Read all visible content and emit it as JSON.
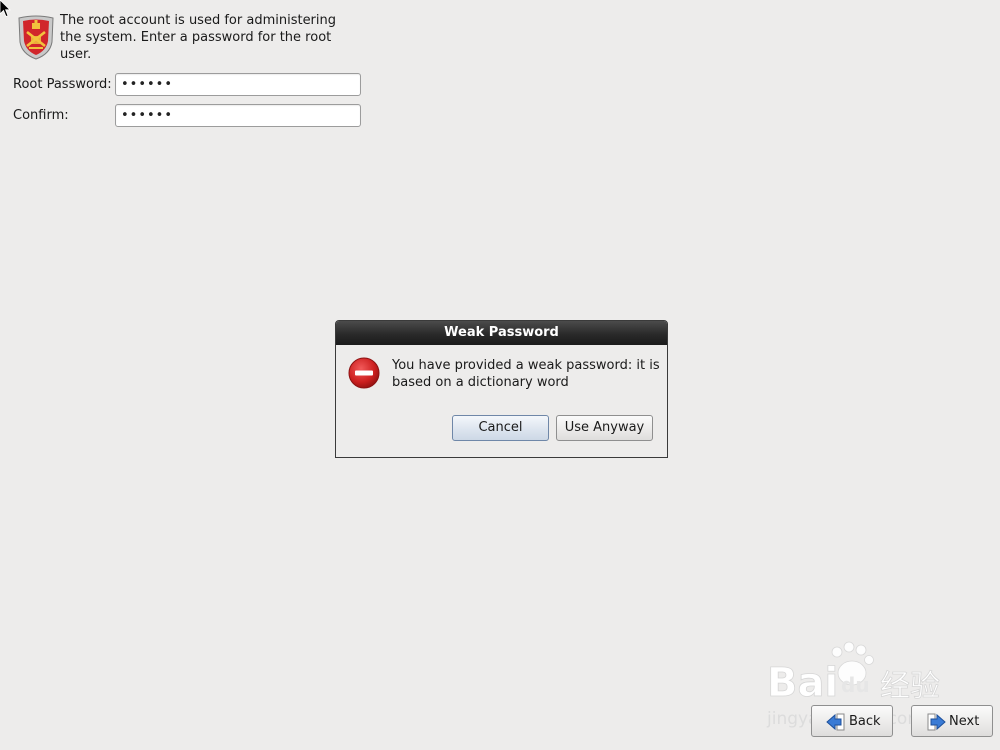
{
  "intro": {
    "text": "The root account is used for administering the system.  Enter a password for the root user."
  },
  "form": {
    "root_password_label": "Root Password:",
    "root_password_value": "••••••",
    "confirm_label": "Confirm:",
    "confirm_value": "••••••"
  },
  "dialog": {
    "title": "Weak Password",
    "message": "You have provided a weak password: it is based on a dictionary word",
    "cancel_label": "Cancel",
    "use_anyway_label": "Use Anyway"
  },
  "nav": {
    "back_label": "Back",
    "next_label": "Next"
  },
  "watermark": {
    "brand": "Bai",
    "brand2": "du",
    "cn": "经验",
    "url": "jingyan.baidu.com"
  },
  "colors": {
    "background": "#edeceb",
    "titlebar": "#2a2a2a",
    "error_red": "#cc1f1f",
    "focus_blue": "#6f87a8"
  }
}
